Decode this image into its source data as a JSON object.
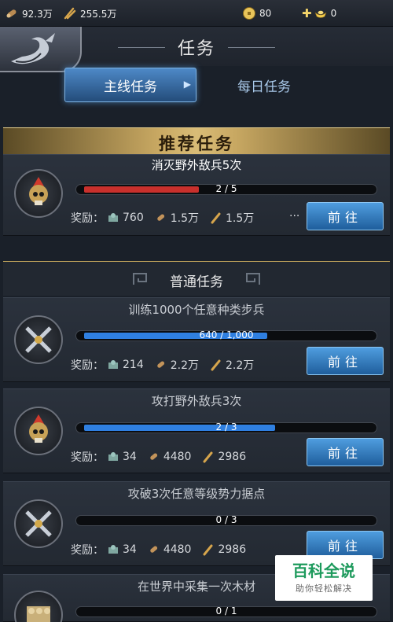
{
  "resources": {
    "wood": "92.3万",
    "food": "255.5万",
    "coins": "80",
    "gold": "0"
  },
  "header": {
    "title": "任务"
  },
  "tabs": [
    {
      "label": "主线任务",
      "active": true
    },
    {
      "label": "每日任务",
      "active": false
    }
  ],
  "recommended": {
    "banner": "推荐任务",
    "task": {
      "title": "消灭野外敌兵5次",
      "progress_text": "2 / 5",
      "progress": 0.4,
      "bar_color": "#c9302c",
      "rewards": [
        {
          "icon": "troops-icon",
          "value": "760"
        },
        {
          "icon": "wood-icon",
          "value": "1.5万"
        },
        {
          "icon": "food-icon",
          "value": "1.5万"
        }
      ],
      "more": "···",
      "button": "前往",
      "portrait": "skull-helmet-icon"
    }
  },
  "normal": {
    "header": "普通任务",
    "reward_label": "奖励：",
    "tasks": [
      {
        "title": "训练1000个任意种类步兵",
        "progress_text": "640 / 1,000",
        "progress": 0.64,
        "rewards": [
          "214",
          "2.2万",
          "2.2万"
        ],
        "button": "前往",
        "portrait": "crossed-swords-icon"
      },
      {
        "title": "攻打野外敌兵3次",
        "progress_text": "2 / 3",
        "progress": 0.667,
        "rewards": [
          "34",
          "4480",
          "2986"
        ],
        "button": "前往",
        "portrait": "skull-helmet-icon"
      },
      {
        "title": "攻破3次任意等级势力据点",
        "progress_text": "0 / 3",
        "progress": 0,
        "rewards": [
          "34",
          "4480",
          "2986"
        ],
        "button": "前往",
        "portrait": "crossed-swords-icon"
      },
      {
        "title": "在世界中采集一次木材",
        "progress_text": "0 / 1",
        "progress": 0,
        "portrait": "wood-pile-icon"
      }
    ]
  },
  "recommended_reward_label": "奖励：",
  "watermark": {
    "title": "百科全说",
    "subtitle": "助你轻松解决"
  },
  "colors": {
    "progress_blue": "#2f7fe0",
    "progress_red": "#c9302c",
    "accent_gold": "#c8a862",
    "button_blue": "#2f79c0"
  }
}
